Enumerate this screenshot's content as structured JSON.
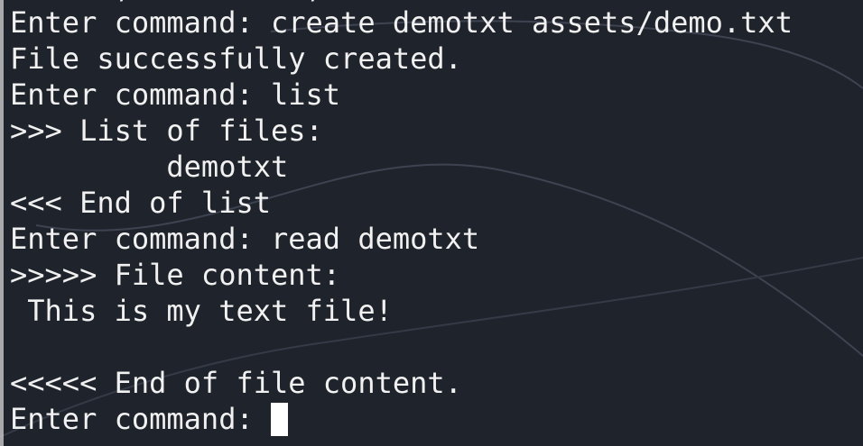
{
  "terminal": {
    "top_fragment": "      ,  .       ,",
    "lines": [
      "Enter command: create demotxt assets/demo.txt",
      "File successfully created.",
      "Enter command: list",
      ">>> List of files:",
      "         demotxt",
      "<<< End of list",
      "Enter command: read demotxt",
      ">>>>> File content:",
      " This is my text file!",
      "",
      "<<<<< End of file content."
    ],
    "prompt": "Enter command: "
  },
  "colors": {
    "background": "#1f232b",
    "text": "#f1f1f1",
    "cursor": "#ffffff",
    "curve": "#3d4350"
  }
}
